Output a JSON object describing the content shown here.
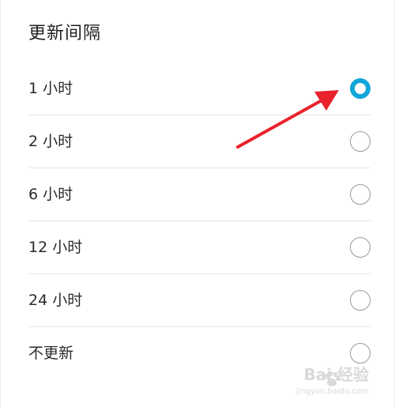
{
  "header": {
    "title": "更新间隔"
  },
  "options": [
    {
      "label": "1 小时",
      "selected": true
    },
    {
      "label": "2 小时",
      "selected": false
    },
    {
      "label": "6 小时",
      "selected": false
    },
    {
      "label": "12 小时",
      "selected": false
    },
    {
      "label": "24 小时",
      "selected": false
    },
    {
      "label": "不更新",
      "selected": false
    }
  ],
  "annotation": {
    "arrow_color": "#e8222b"
  },
  "watermark": {
    "brand": "Bai 经验",
    "url": "jingyan.baidu.com"
  },
  "colors": {
    "accent": "#12a6d8",
    "divider": "#e6e6e6"
  }
}
